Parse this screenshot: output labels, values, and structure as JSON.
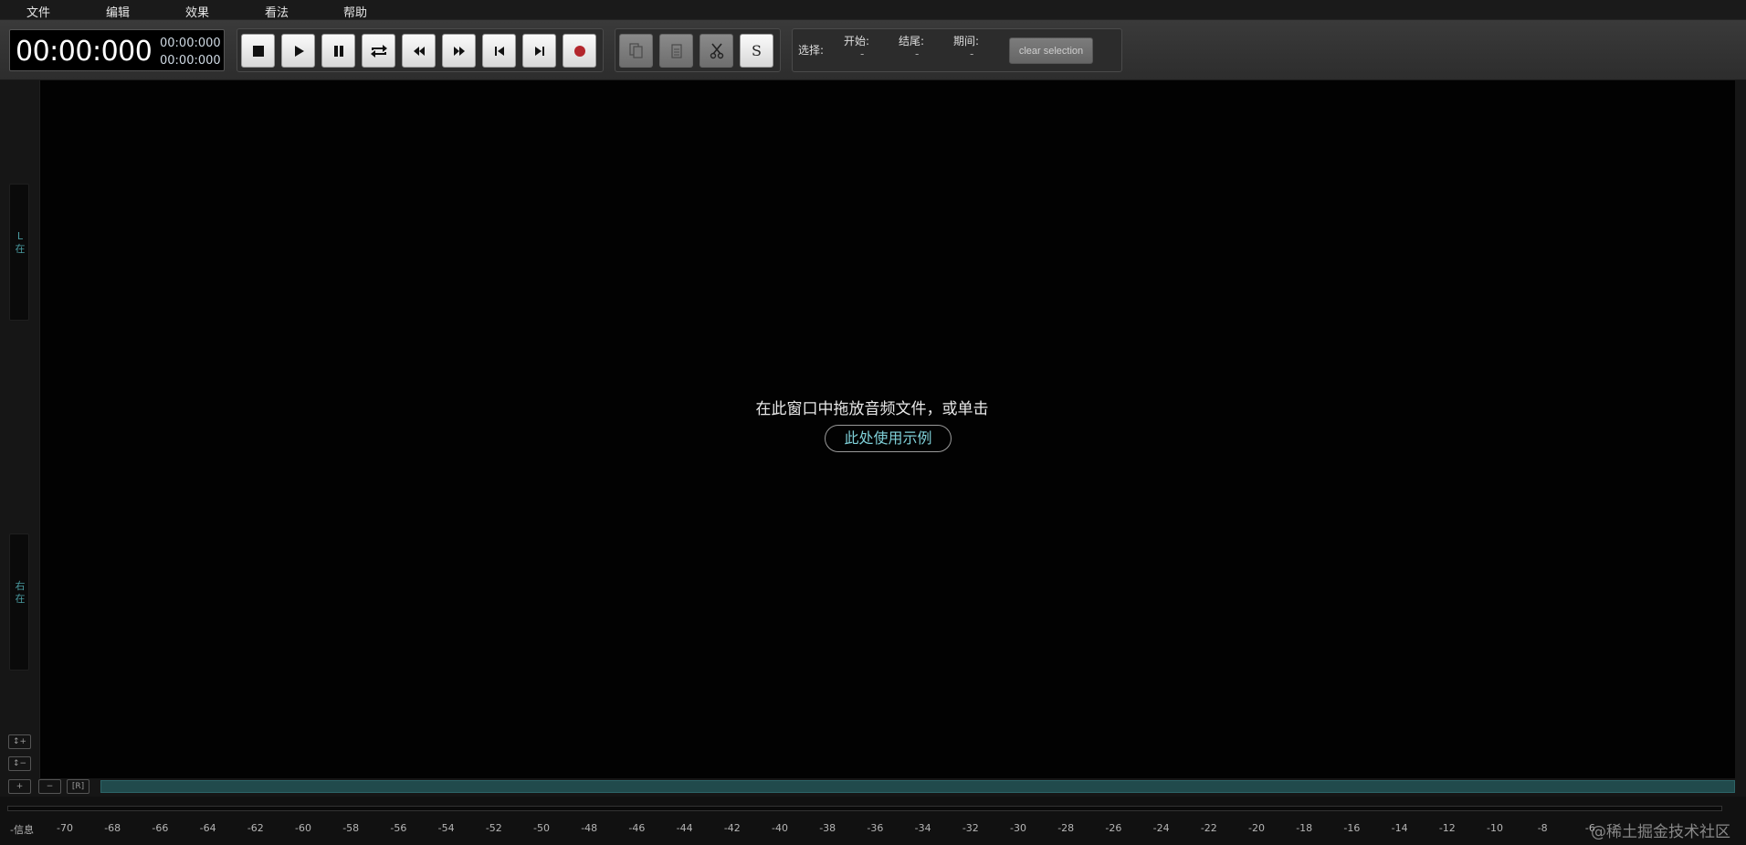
{
  "menu": [
    "文件",
    "编辑",
    "效果",
    "看法",
    "帮助"
  ],
  "time": {
    "main": "00:00:000",
    "position": "00:00:000",
    "duration": "00:00:000"
  },
  "transport": {
    "buttons": [
      "stop-icon",
      "play-icon",
      "pause-icon",
      "loop-icon",
      "rewind-icon",
      "fast-forward-icon",
      "skip-to-start-icon",
      "skip-to-end-icon",
      "record-icon"
    ],
    "record_color": "#b3262c"
  },
  "edit": {
    "buttons": [
      "copy-icon",
      "paste-icon",
      "cut-icon"
    ],
    "s_label": "S"
  },
  "selection": {
    "label": "选择:",
    "start_label": "开始:",
    "start_value": "-",
    "end_label": "结尾:",
    "end_value": "-",
    "duration_label": "期间:",
    "duration_value": "-",
    "clear_label": "clear selection"
  },
  "channels": {
    "left": [
      "L",
      "在"
    ],
    "right": [
      "右",
      "在"
    ]
  },
  "zoom": {
    "v_plus": "↕+",
    "v_minus": "↕−",
    "h_plus": "+",
    "h_minus": "−",
    "h_reset": "[R]"
  },
  "empty_state": {
    "message": "在此窗口中拖放音频文件，或单击",
    "demo_link": "此处使用示例"
  },
  "meter": {
    "first_label": "-信息",
    "ticks": [
      "-70",
      "-68",
      "-66",
      "-64",
      "-62",
      "-60",
      "-58",
      "-56",
      "-54",
      "-52",
      "-50",
      "-48",
      "-46",
      "-44",
      "-42",
      "-40",
      "-38",
      "-36",
      "-34",
      "-32",
      "-30",
      "-28",
      "-26",
      "-24",
      "-22",
      "-20",
      "-18",
      "-16",
      "-14",
      "-12",
      "-10",
      "-8",
      "-6"
    ]
  },
  "watermark": "@稀土掘金技术社区",
  "colors": {
    "accent": "#4a9aa0",
    "overview": "#214a4c"
  }
}
